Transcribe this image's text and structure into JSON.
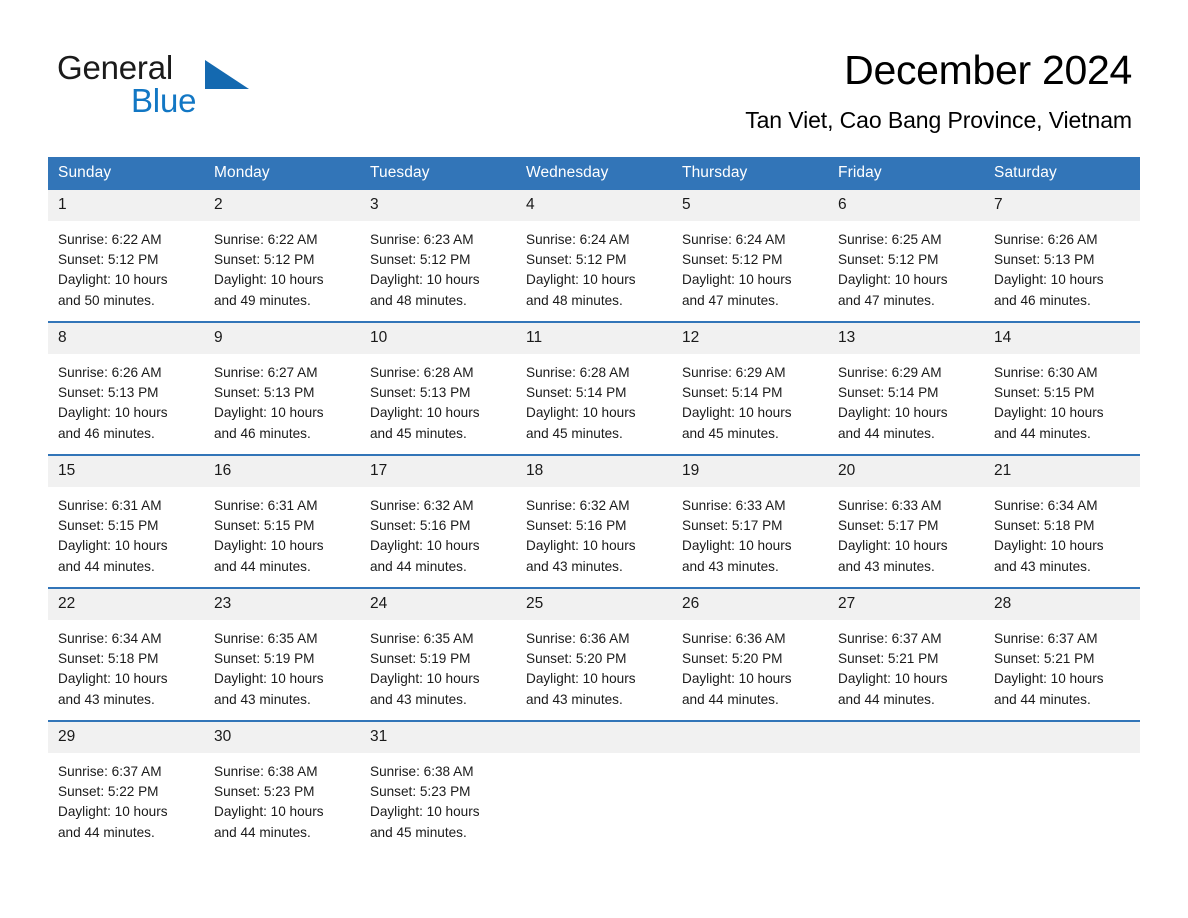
{
  "brand": {
    "name_part1": "General",
    "name_part2": "Blue",
    "logo_icon": "triangle-flag-icon",
    "accent_color": "#1469b0",
    "text_color": "#1277c4"
  },
  "header": {
    "title": "December 2024",
    "location": "Tan Viet, Cao Bang Province, Vietnam"
  },
  "colors": {
    "header_band": "#3275b8",
    "daynum_strip": "#f1f1f1",
    "row_divider": "#3275b8",
    "text": "#1a1a1a"
  },
  "weekday_headers": [
    "Sunday",
    "Monday",
    "Tuesday",
    "Wednesday",
    "Thursday",
    "Friday",
    "Saturday"
  ],
  "weeks": [
    [
      {
        "day": "1",
        "sunrise": "Sunrise: 6:22 AM",
        "sunset": "Sunset: 5:12 PM",
        "daylight_line1": "Daylight: 10 hours",
        "daylight_line2": "and 50 minutes."
      },
      {
        "day": "2",
        "sunrise": "Sunrise: 6:22 AM",
        "sunset": "Sunset: 5:12 PM",
        "daylight_line1": "Daylight: 10 hours",
        "daylight_line2": "and 49 minutes."
      },
      {
        "day": "3",
        "sunrise": "Sunrise: 6:23 AM",
        "sunset": "Sunset: 5:12 PM",
        "daylight_line1": "Daylight: 10 hours",
        "daylight_line2": "and 48 minutes."
      },
      {
        "day": "4",
        "sunrise": "Sunrise: 6:24 AM",
        "sunset": "Sunset: 5:12 PM",
        "daylight_line1": "Daylight: 10 hours",
        "daylight_line2": "and 48 minutes."
      },
      {
        "day": "5",
        "sunrise": "Sunrise: 6:24 AM",
        "sunset": "Sunset: 5:12 PM",
        "daylight_line1": "Daylight: 10 hours",
        "daylight_line2": "and 47 minutes."
      },
      {
        "day": "6",
        "sunrise": "Sunrise: 6:25 AM",
        "sunset": "Sunset: 5:12 PM",
        "daylight_line1": "Daylight: 10 hours",
        "daylight_line2": "and 47 minutes."
      },
      {
        "day": "7",
        "sunrise": "Sunrise: 6:26 AM",
        "sunset": "Sunset: 5:13 PM",
        "daylight_line1": "Daylight: 10 hours",
        "daylight_line2": "and 46 minutes."
      }
    ],
    [
      {
        "day": "8",
        "sunrise": "Sunrise: 6:26 AM",
        "sunset": "Sunset: 5:13 PM",
        "daylight_line1": "Daylight: 10 hours",
        "daylight_line2": "and 46 minutes."
      },
      {
        "day": "9",
        "sunrise": "Sunrise: 6:27 AM",
        "sunset": "Sunset: 5:13 PM",
        "daylight_line1": "Daylight: 10 hours",
        "daylight_line2": "and 46 minutes."
      },
      {
        "day": "10",
        "sunrise": "Sunrise: 6:28 AM",
        "sunset": "Sunset: 5:13 PM",
        "daylight_line1": "Daylight: 10 hours",
        "daylight_line2": "and 45 minutes."
      },
      {
        "day": "11",
        "sunrise": "Sunrise: 6:28 AM",
        "sunset": "Sunset: 5:14 PM",
        "daylight_line1": "Daylight: 10 hours",
        "daylight_line2": "and 45 minutes."
      },
      {
        "day": "12",
        "sunrise": "Sunrise: 6:29 AM",
        "sunset": "Sunset: 5:14 PM",
        "daylight_line1": "Daylight: 10 hours",
        "daylight_line2": "and 45 minutes."
      },
      {
        "day": "13",
        "sunrise": "Sunrise: 6:29 AM",
        "sunset": "Sunset: 5:14 PM",
        "daylight_line1": "Daylight: 10 hours",
        "daylight_line2": "and 44 minutes."
      },
      {
        "day": "14",
        "sunrise": "Sunrise: 6:30 AM",
        "sunset": "Sunset: 5:15 PM",
        "daylight_line1": "Daylight: 10 hours",
        "daylight_line2": "and 44 minutes."
      }
    ],
    [
      {
        "day": "15",
        "sunrise": "Sunrise: 6:31 AM",
        "sunset": "Sunset: 5:15 PM",
        "daylight_line1": "Daylight: 10 hours",
        "daylight_line2": "and 44 minutes."
      },
      {
        "day": "16",
        "sunrise": "Sunrise: 6:31 AM",
        "sunset": "Sunset: 5:15 PM",
        "daylight_line1": "Daylight: 10 hours",
        "daylight_line2": "and 44 minutes."
      },
      {
        "day": "17",
        "sunrise": "Sunrise: 6:32 AM",
        "sunset": "Sunset: 5:16 PM",
        "daylight_line1": "Daylight: 10 hours",
        "daylight_line2": "and 44 minutes."
      },
      {
        "day": "18",
        "sunrise": "Sunrise: 6:32 AM",
        "sunset": "Sunset: 5:16 PM",
        "daylight_line1": "Daylight: 10 hours",
        "daylight_line2": "and 43 minutes."
      },
      {
        "day": "19",
        "sunrise": "Sunrise: 6:33 AM",
        "sunset": "Sunset: 5:17 PM",
        "daylight_line1": "Daylight: 10 hours",
        "daylight_line2": "and 43 minutes."
      },
      {
        "day": "20",
        "sunrise": "Sunrise: 6:33 AM",
        "sunset": "Sunset: 5:17 PM",
        "daylight_line1": "Daylight: 10 hours",
        "daylight_line2": "and 43 minutes."
      },
      {
        "day": "21",
        "sunrise": "Sunrise: 6:34 AM",
        "sunset": "Sunset: 5:18 PM",
        "daylight_line1": "Daylight: 10 hours",
        "daylight_line2": "and 43 minutes."
      }
    ],
    [
      {
        "day": "22",
        "sunrise": "Sunrise: 6:34 AM",
        "sunset": "Sunset: 5:18 PM",
        "daylight_line1": "Daylight: 10 hours",
        "daylight_line2": "and 43 minutes."
      },
      {
        "day": "23",
        "sunrise": "Sunrise: 6:35 AM",
        "sunset": "Sunset: 5:19 PM",
        "daylight_line1": "Daylight: 10 hours",
        "daylight_line2": "and 43 minutes."
      },
      {
        "day": "24",
        "sunrise": "Sunrise: 6:35 AM",
        "sunset": "Sunset: 5:19 PM",
        "daylight_line1": "Daylight: 10 hours",
        "daylight_line2": "and 43 minutes."
      },
      {
        "day": "25",
        "sunrise": "Sunrise: 6:36 AM",
        "sunset": "Sunset: 5:20 PM",
        "daylight_line1": "Daylight: 10 hours",
        "daylight_line2": "and 43 minutes."
      },
      {
        "day": "26",
        "sunrise": "Sunrise: 6:36 AM",
        "sunset": "Sunset: 5:20 PM",
        "daylight_line1": "Daylight: 10 hours",
        "daylight_line2": "and 44 minutes."
      },
      {
        "day": "27",
        "sunrise": "Sunrise: 6:37 AM",
        "sunset": "Sunset: 5:21 PM",
        "daylight_line1": "Daylight: 10 hours",
        "daylight_line2": "and 44 minutes."
      },
      {
        "day": "28",
        "sunrise": "Sunrise: 6:37 AM",
        "sunset": "Sunset: 5:21 PM",
        "daylight_line1": "Daylight: 10 hours",
        "daylight_line2": "and 44 minutes."
      }
    ],
    [
      {
        "day": "29",
        "sunrise": "Sunrise: 6:37 AM",
        "sunset": "Sunset: 5:22 PM",
        "daylight_line1": "Daylight: 10 hours",
        "daylight_line2": "and 44 minutes."
      },
      {
        "day": "30",
        "sunrise": "Sunrise: 6:38 AM",
        "sunset": "Sunset: 5:23 PM",
        "daylight_line1": "Daylight: 10 hours",
        "daylight_line2": "and 44 minutes."
      },
      {
        "day": "31",
        "sunrise": "Sunrise: 6:38 AM",
        "sunset": "Sunset: 5:23 PM",
        "daylight_line1": "Daylight: 10 hours",
        "daylight_line2": "and 45 minutes."
      },
      {
        "day": "",
        "sunrise": "",
        "sunset": "",
        "daylight_line1": "",
        "daylight_line2": ""
      },
      {
        "day": "",
        "sunrise": "",
        "sunset": "",
        "daylight_line1": "",
        "daylight_line2": ""
      },
      {
        "day": "",
        "sunrise": "",
        "sunset": "",
        "daylight_line1": "",
        "daylight_line2": ""
      },
      {
        "day": "",
        "sunrise": "",
        "sunset": "",
        "daylight_line1": "",
        "daylight_line2": ""
      }
    ]
  ]
}
